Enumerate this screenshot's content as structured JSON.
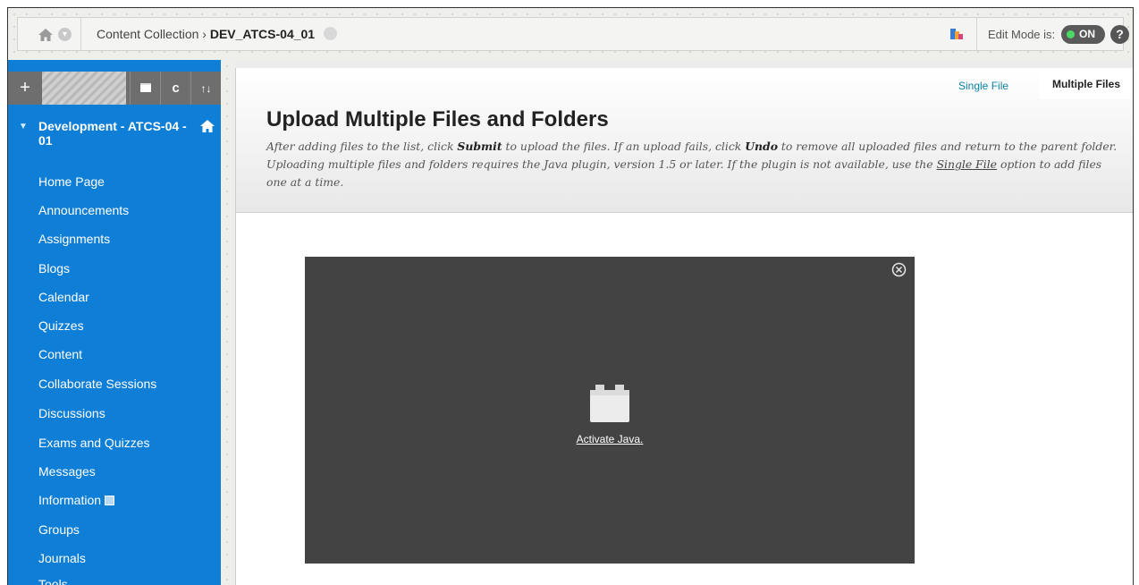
{
  "topbar": {
    "breadcrumb_root": "Content Collection",
    "breadcrumb_separator": "›",
    "breadcrumb_current": "DEV_ATCS-04_01",
    "edit_mode_label": "Edit Mode is:",
    "edit_mode_state": "ON",
    "help_label": "?"
  },
  "sidebar": {
    "toolbar": {
      "add": "+",
      "refresh": "c",
      "sort": "↑↓"
    },
    "course_title": "Development - ATCS-04 - 01",
    "items": [
      {
        "label": "Home Page"
      },
      {
        "label": "Announcements"
      },
      {
        "label": "Assignments"
      },
      {
        "label": "Blogs"
      },
      {
        "label": "Calendar"
      },
      {
        "label": "Quizzes"
      },
      {
        "label": "Content"
      },
      {
        "label": "Collaborate Sessions"
      },
      {
        "label": "Discussions"
      },
      {
        "label": "Exams and Quizzes"
      },
      {
        "label": "Messages"
      },
      {
        "label": "Information"
      },
      {
        "label": "Groups"
      },
      {
        "label": "Journals"
      },
      {
        "label": "Tools"
      }
    ]
  },
  "content": {
    "tabs": {
      "single": "Single File",
      "multiple": "Multiple Files"
    },
    "title": "Upload Multiple Files and Folders",
    "instructions": {
      "p1": "After adding files to the list, click ",
      "submit": "Submit",
      "p2": " to upload the files. If an upload fails, click ",
      "undo": "Undo",
      "p3": " to remove all uploaded files and return to the parent folder. Uploading multiple files and folders requires the Java plugin, version 1.5 or later. If the plugin is not available, use the ",
      "link": "Single File",
      "p4": " option to add files one at a time."
    },
    "java_panel": {
      "link": "Activate Java."
    }
  },
  "colors": {
    "sidebar_bg": "#0f7ed6",
    "toggle_on": "#4cd964",
    "panel_bg": "#434343",
    "link": "#0b7fa8"
  }
}
